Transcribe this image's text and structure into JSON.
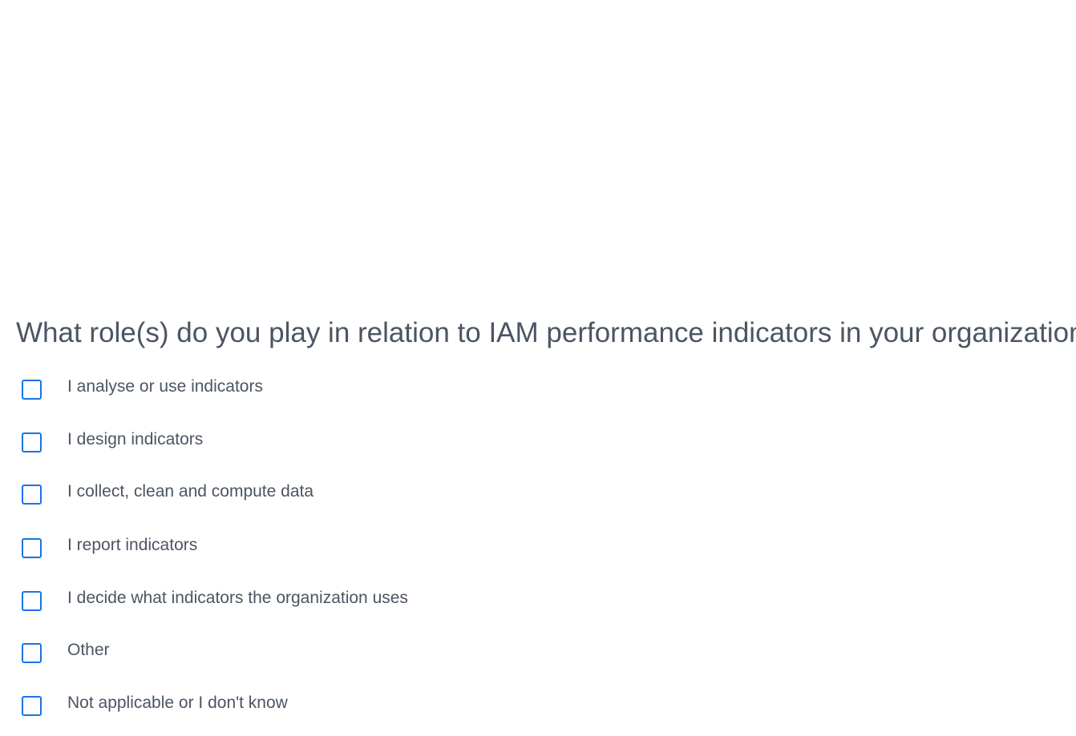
{
  "survey": {
    "question": "What role(s) do you play in relation to IAM performance indicators in your organization?",
    "options": [
      {
        "label": "I analyse or use indicators",
        "checked": false
      },
      {
        "label": "I design indicators",
        "checked": false
      },
      {
        "label": "I collect, clean and compute data",
        "checked": false
      },
      {
        "label": "I report indicators",
        "checked": false
      },
      {
        "label": "I decide what indicators the organization uses",
        "checked": false
      },
      {
        "label": "Other",
        "checked": false
      },
      {
        "label": "Not applicable or I don't know",
        "checked": false
      }
    ]
  },
  "colors": {
    "checkbox_border": "#1a73e8",
    "text": "#4b5563",
    "background": "#ffffff"
  }
}
